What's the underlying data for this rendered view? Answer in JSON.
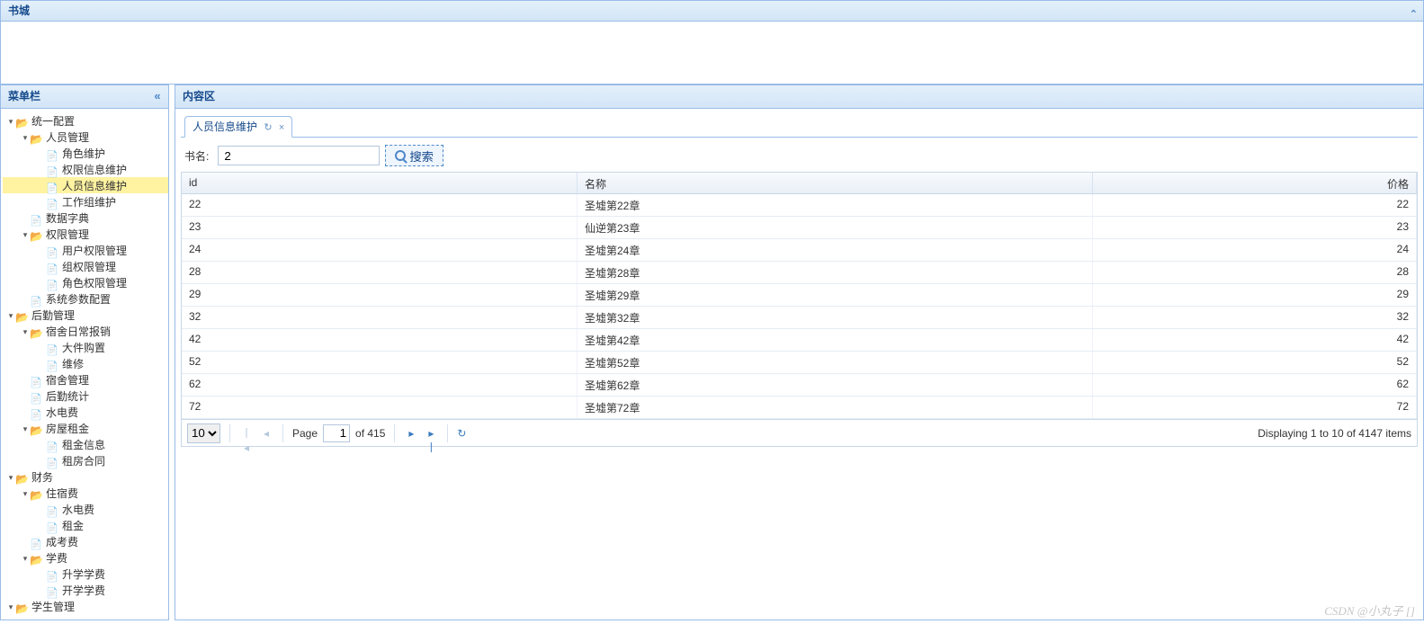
{
  "app": {
    "title": "书城"
  },
  "sidebar": {
    "title": "菜单栏",
    "nodes": [
      {
        "lvl": 0,
        "type": "folder",
        "open": true,
        "label": "统一配置"
      },
      {
        "lvl": 1,
        "type": "folder",
        "open": true,
        "label": "人员管理"
      },
      {
        "lvl": 2,
        "type": "file",
        "label": "角色维护"
      },
      {
        "lvl": 2,
        "type": "file",
        "label": "权限信息维护"
      },
      {
        "lvl": 2,
        "type": "file",
        "label": "人员信息维护",
        "selected": true
      },
      {
        "lvl": 2,
        "type": "file",
        "label": "工作组维护"
      },
      {
        "lvl": 1,
        "type": "file",
        "label": "数据字典"
      },
      {
        "lvl": 1,
        "type": "folder",
        "open": true,
        "label": "权限管理"
      },
      {
        "lvl": 2,
        "type": "file",
        "label": "用户权限管理"
      },
      {
        "lvl": 2,
        "type": "file",
        "label": "组权限管理"
      },
      {
        "lvl": 2,
        "type": "file",
        "label": "角色权限管理"
      },
      {
        "lvl": 1,
        "type": "file",
        "label": "系统参数配置"
      },
      {
        "lvl": 0,
        "type": "folder",
        "open": true,
        "label": "后勤管理"
      },
      {
        "lvl": 1,
        "type": "folder",
        "open": true,
        "label": "宿舍日常报销"
      },
      {
        "lvl": 2,
        "type": "file",
        "label": "大件购置"
      },
      {
        "lvl": 2,
        "type": "file",
        "label": "维修"
      },
      {
        "lvl": 1,
        "type": "file",
        "label": "宿舍管理"
      },
      {
        "lvl": 1,
        "type": "file",
        "label": "后勤统计"
      },
      {
        "lvl": 1,
        "type": "file",
        "label": "水电费"
      },
      {
        "lvl": 1,
        "type": "folder",
        "open": true,
        "label": "房屋租金"
      },
      {
        "lvl": 2,
        "type": "file",
        "label": "租金信息"
      },
      {
        "lvl": 2,
        "type": "file",
        "label": "租房合同"
      },
      {
        "lvl": 0,
        "type": "folder",
        "open": true,
        "label": "财务"
      },
      {
        "lvl": 1,
        "type": "folder",
        "open": true,
        "label": "住宿费"
      },
      {
        "lvl": 2,
        "type": "file",
        "label": "水电费"
      },
      {
        "lvl": 2,
        "type": "file",
        "label": "租金"
      },
      {
        "lvl": 1,
        "type": "file",
        "label": "成考费"
      },
      {
        "lvl": 1,
        "type": "folder",
        "open": true,
        "label": "学费"
      },
      {
        "lvl": 2,
        "type": "file",
        "label": "升学学费"
      },
      {
        "lvl": 2,
        "type": "file",
        "label": "开学学费"
      },
      {
        "lvl": 0,
        "type": "folder",
        "open": true,
        "label": "学生管理"
      }
    ]
  },
  "content": {
    "title": "内容区",
    "tab": {
      "label": "人员信息维护"
    },
    "search": {
      "label": "书名:",
      "value": "2",
      "button": "搜索"
    },
    "grid": {
      "headers": {
        "id": "id",
        "name": "名称",
        "price": "价格"
      },
      "rows": [
        {
          "id": "22",
          "name": "圣墟第22章",
          "price": "22"
        },
        {
          "id": "23",
          "name": "仙逆第23章",
          "price": "23"
        },
        {
          "id": "24",
          "name": "圣墟第24章",
          "price": "24"
        },
        {
          "id": "28",
          "name": "圣墟第28章",
          "price": "28"
        },
        {
          "id": "29",
          "name": "圣墟第29章",
          "price": "29"
        },
        {
          "id": "32",
          "name": "圣墟第32章",
          "price": "32"
        },
        {
          "id": "42",
          "name": "圣墟第42章",
          "price": "42"
        },
        {
          "id": "52",
          "name": "圣墟第52章",
          "price": "52"
        },
        {
          "id": "62",
          "name": "圣墟第62章",
          "price": "62"
        },
        {
          "id": "72",
          "name": "圣墟第72章",
          "price": "72"
        }
      ]
    },
    "pager": {
      "pageSize": "10",
      "pageLabel": "Page",
      "pageValue": "1",
      "ofLabel": "of 415",
      "displayText": "Displaying 1 to 10 of 4147 items"
    }
  },
  "watermark": "CSDN @小丸子 []"
}
